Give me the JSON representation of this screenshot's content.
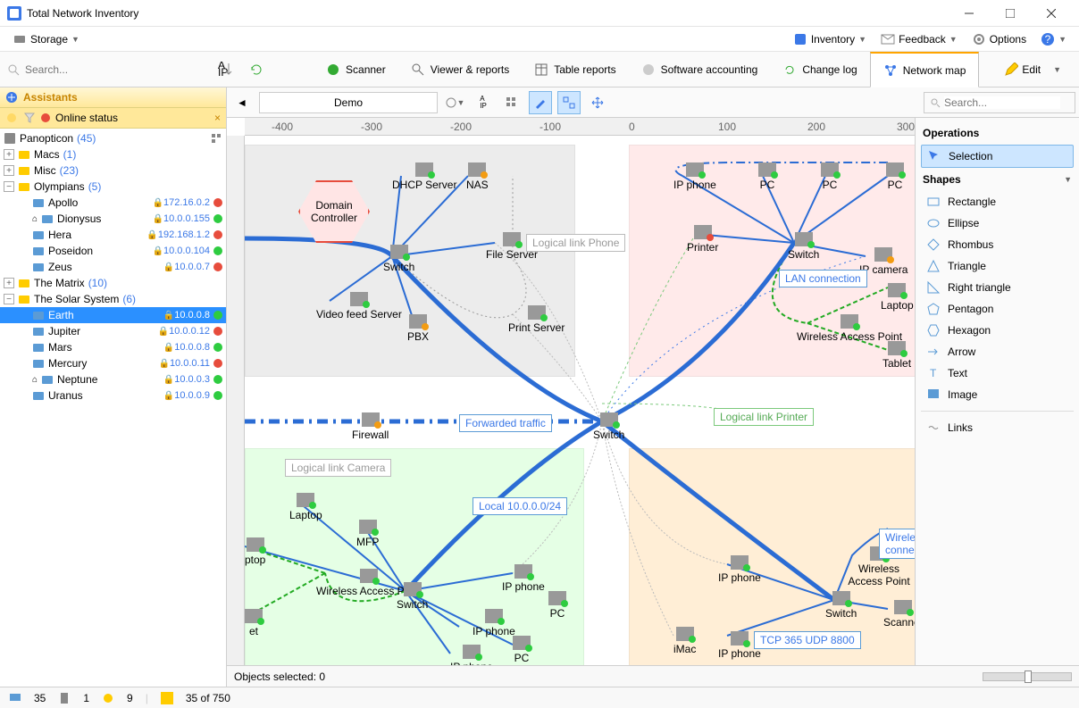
{
  "window": {
    "title": "Total Network Inventory"
  },
  "toolbar1": {
    "storage": "Storage",
    "inventory": "Inventory",
    "feedback": "Feedback",
    "options": "Options"
  },
  "toolbar2": {
    "search_placeholder": "Search...",
    "tabs": [
      {
        "label": "Scanner"
      },
      {
        "label": "Viewer & reports"
      },
      {
        "label": "Table reports"
      },
      {
        "label": "Software accounting"
      },
      {
        "label": "Change log"
      },
      {
        "label": "Network map"
      }
    ],
    "edit": "Edit"
  },
  "sidebar": {
    "assistants": "Assistants",
    "online_status": "Online status",
    "root": {
      "name": "Panopticon",
      "count": "(45)"
    },
    "groups": [
      {
        "name": "Macs",
        "count": "(1)",
        "expanded": false
      },
      {
        "name": "Misc",
        "count": "(23)",
        "expanded": false
      },
      {
        "name": "Olympians",
        "count": "(5)",
        "expanded": true,
        "children": [
          {
            "name": "Apollo",
            "ip": "172.16.0.2",
            "status": "r",
            "icon": "pc"
          },
          {
            "name": "Dionysus",
            "ip": "10.0.0.155",
            "status": "g",
            "icon": "pc",
            "home": true
          },
          {
            "name": "Hera",
            "ip": "192.168.1.2",
            "status": "r",
            "icon": "pc"
          },
          {
            "name": "Poseidon",
            "ip": "10.0.0.104",
            "status": "g",
            "icon": "pc"
          },
          {
            "name": "Zeus",
            "ip": "10.0.0.7",
            "status": "r",
            "icon": "pc"
          }
        ]
      },
      {
        "name": "The Matrix",
        "count": "(10)",
        "expanded": false
      },
      {
        "name": "The Solar System",
        "count": "(6)",
        "expanded": true,
        "children": [
          {
            "name": "Earth",
            "ip": "10.0.0.8",
            "status": "g",
            "icon": "pc",
            "selected": true
          },
          {
            "name": "Jupiter",
            "ip": "10.0.0.12",
            "status": "r",
            "icon": "pc"
          },
          {
            "name": "Mars",
            "ip": "10.0.0.8",
            "status": "g",
            "icon": "pc"
          },
          {
            "name": "Mercury",
            "ip": "10.0.0.11",
            "status": "r",
            "icon": "pc"
          },
          {
            "name": "Neptune",
            "ip": "10.0.0.3",
            "status": "g",
            "icon": "pc",
            "home": true
          },
          {
            "name": "Uranus",
            "ip": "10.0.0.9",
            "status": "g",
            "icon": "pc"
          }
        ]
      }
    ]
  },
  "canvas": {
    "current": "Demo",
    "search_placeholder": "Search...",
    "ruler_h": [
      "-400",
      "-300",
      "-200",
      "-100",
      "0",
      "100",
      "200",
      "300"
    ],
    "status": "Objects selected: 0",
    "labels": {
      "logical_phone": "Logical link Phone",
      "lan_conn": "LAN connection",
      "forwarded": "Forwarded traffic",
      "logical_printer": "Logical link Printer",
      "logical_camera": "Logical link Camera",
      "local_net": "Local 10.0.0.0/24",
      "wireless_conn": "Wireless connection",
      "tcp": "TCP 365 UDP 8800"
    },
    "nodes": {
      "domain_controller": "Domain Controller",
      "dhcp": "DHCP Server",
      "nas": "NAS",
      "file_server": "File Server",
      "switch": "Switch",
      "video_feed": "Video feed Server",
      "pbx": "PBX",
      "print_server": "Print Server",
      "ip_phone": "IP phone",
      "pc": "PC",
      "printer": "Printer",
      "ip_camera": "IP camera",
      "wap": "Wireless Access Point",
      "laptop": "Laptop",
      "tablet": "Tablet",
      "firewall": "Firewall",
      "mfp": "MFP",
      "imac": "iMac",
      "scanner": "Scanner",
      "ptop": "ptop",
      "et": "et"
    }
  },
  "rpanel": {
    "operations": "Operations",
    "selection": "Selection",
    "shapes": "Shapes",
    "items": [
      "Rectangle",
      "Ellipse",
      "Rhombus",
      "Triangle",
      "Right triangle",
      "Pentagon",
      "Hexagon",
      "Arrow",
      "Text",
      "Image"
    ],
    "links": "Links"
  },
  "footer": {
    "pc": "35",
    "srv": "1",
    "other": "9",
    "shown": "35 of 750"
  }
}
